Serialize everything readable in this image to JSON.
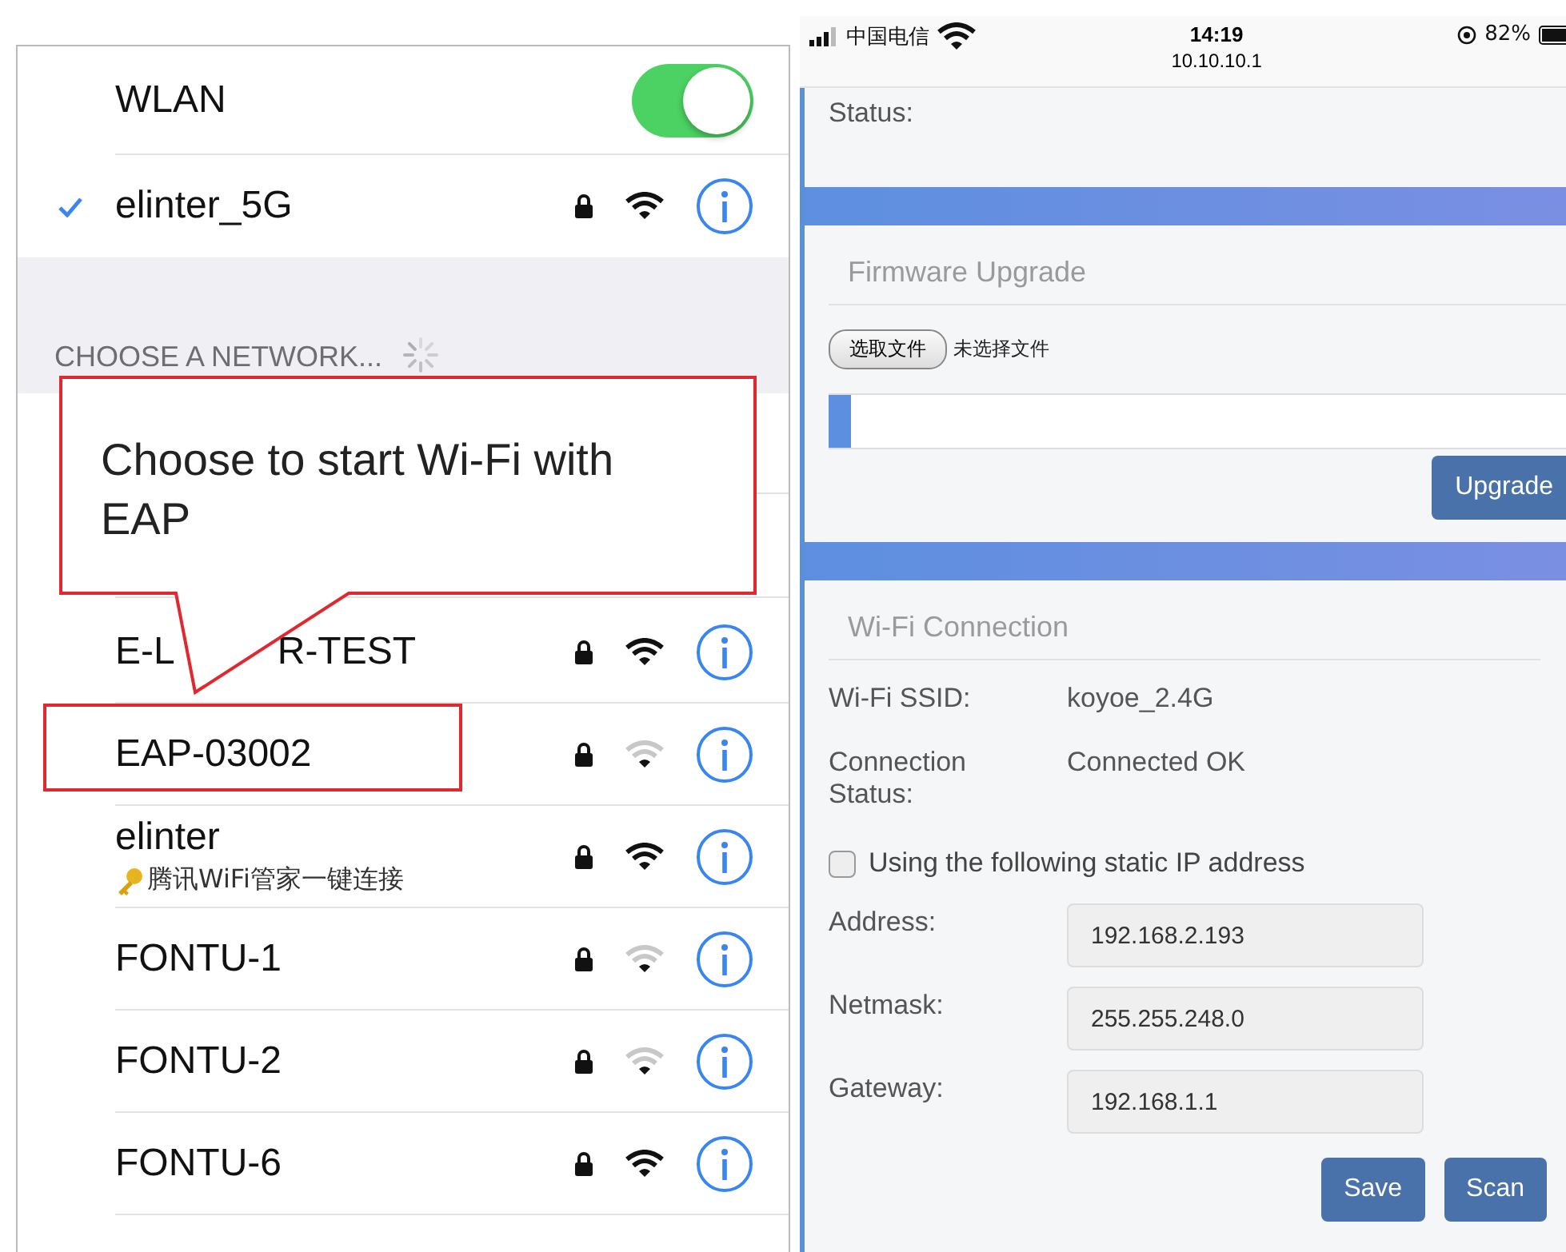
{
  "left_screen": {
    "wlan": {
      "label": "WLAN",
      "on": true
    },
    "connected_network": {
      "name": "elinter_5G",
      "connected": true,
      "weak_signal": false
    },
    "section_header": "CHOOSE A NETWORK...",
    "networks": [
      {
        "name_parts": [
          "E-L",
          "R-TEST"
        ],
        "weak_signal": false,
        "highlighted": false
      },
      {
        "name_parts": [
          "EAP-03002"
        ],
        "weak_signal": true,
        "highlighted": true
      },
      {
        "name_parts": [
          "elinter"
        ],
        "subtitle": "腾讯WiFi管家一键连接",
        "weak_signal": false,
        "highlighted": false
      },
      {
        "name_parts": [
          "FONTU-1"
        ],
        "weak_signal": true,
        "highlighted": false
      },
      {
        "name_parts": [
          "FONTU-2"
        ],
        "weak_signal": true,
        "highlighted": false
      },
      {
        "name_parts": [
          "FONTU-6"
        ],
        "weak_signal": false,
        "highlighted": false
      }
    ],
    "callout": {
      "text": "Choose to start Wi-Fi with EAP"
    }
  },
  "right_screen": {
    "status_bar": {
      "carrier": "中国电信",
      "time": "14:19",
      "url": "10.10.10.1",
      "battery": "82%"
    },
    "status_label": "Status:",
    "firmware": {
      "title": "Firmware Upgrade",
      "file_button": "选取文件",
      "file_status": "未选择文件",
      "level": 0.03,
      "upgrade_button": "Upgrade"
    },
    "wifi": {
      "title": "Wi-Fi Connection",
      "info": [
        {
          "label": "Wi-Fi SSID:",
          "value": "koyoe_2.4G"
        },
        {
          "label": "Connection Status:",
          "value": "Connected OK"
        }
      ],
      "static_ip": {
        "label": "Using the following static IP address",
        "checked": false
      },
      "fields": [
        {
          "label": "Address:",
          "value": "192.168.2.193"
        },
        {
          "label": "Netmask:",
          "value": "255.255.248.0"
        },
        {
          "label": "Gateway:",
          "value": "192.168.1.1"
        }
      ],
      "buttons": [
        "Save",
        "Scan"
      ]
    }
  }
}
